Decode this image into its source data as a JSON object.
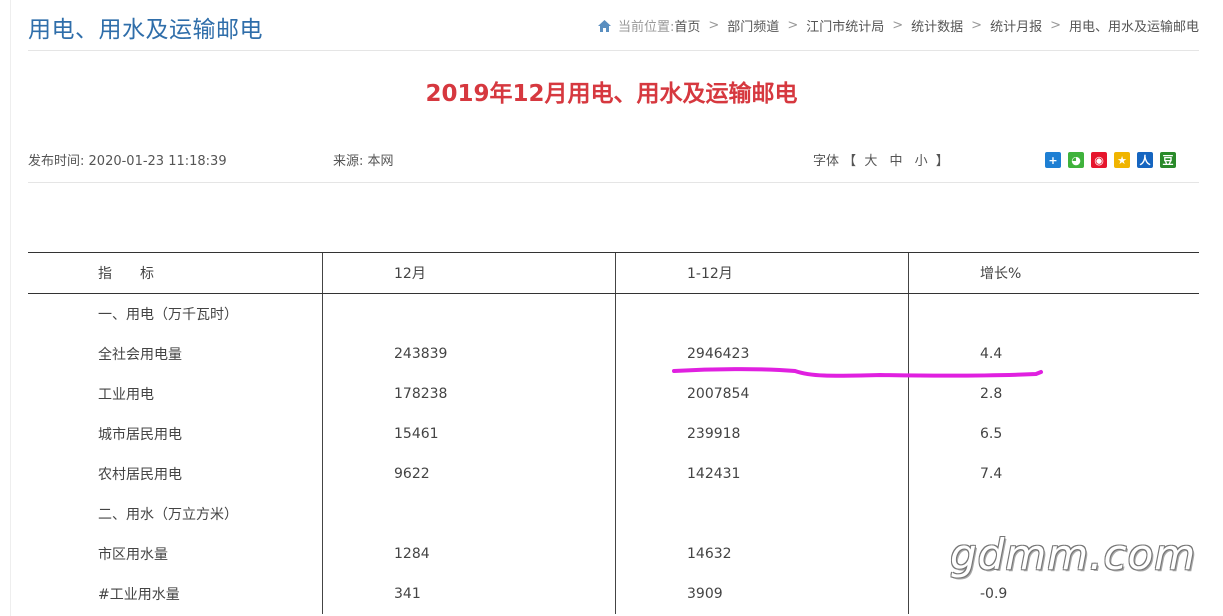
{
  "header": {
    "section_title": "用电、用水及运输邮电",
    "breadcrumb_prefix": "当前位置:",
    "breadcrumb": [
      "首页",
      "部门频道",
      "江门市统计局",
      "统计数据",
      "统计月报",
      "用电、用水及运输邮电"
    ],
    "separator": ">"
  },
  "article": {
    "title": "2019年12月用电、用水及运输邮电",
    "publish_label": "发布时间:",
    "publish_time": "2020-01-23 11:18:39",
    "source_label": "来源:",
    "source": "本网",
    "font_label": "字体",
    "bracket_open": "【",
    "bracket_close": "】",
    "font_sizes": [
      "大",
      "中",
      "小"
    ]
  },
  "share": [
    {
      "icon": "plus-share-icon",
      "color": "#1e7fd3",
      "glyph": "+"
    },
    {
      "icon": "wechat-icon",
      "color": "#3fb23c",
      "glyph": "◕"
    },
    {
      "icon": "weibo-icon",
      "color": "#e6162d",
      "glyph": "◉"
    },
    {
      "icon": "qzone-star-icon",
      "color": "#f0b400",
      "glyph": "★"
    },
    {
      "icon": "renren-icon",
      "color": "#1565c0",
      "glyph": "人"
    },
    {
      "icon": "douban-icon",
      "color": "#2a8a2a",
      "glyph": "豆"
    }
  ],
  "table": {
    "headers": [
      "指　　标",
      "12月",
      "1-12月",
      "增长%"
    ],
    "rows": [
      [
        "一、用电（万千瓦时）",
        "",
        "",
        ""
      ],
      [
        "全社会用电量",
        "243839",
        "2946423",
        "4.4"
      ],
      [
        "工业用电",
        "178238",
        "2007854",
        "2.8"
      ],
      [
        "城市居民用电",
        "15461",
        "239918",
        "6.5"
      ],
      [
        "农村居民用电",
        "9622",
        "142431",
        "7.4"
      ],
      [
        "二、用水（万立方米）",
        "",
        "",
        ""
      ],
      [
        "市区用水量",
        "1284",
        "14632",
        ""
      ],
      [
        "#工业用水量",
        "341",
        "3909",
        "-0.9"
      ]
    ]
  },
  "watermark": "gdmm.com",
  "colors": {
    "section_title": "#2f6eaa",
    "article_title": "#d6383f",
    "annotation": "#e020e0"
  }
}
